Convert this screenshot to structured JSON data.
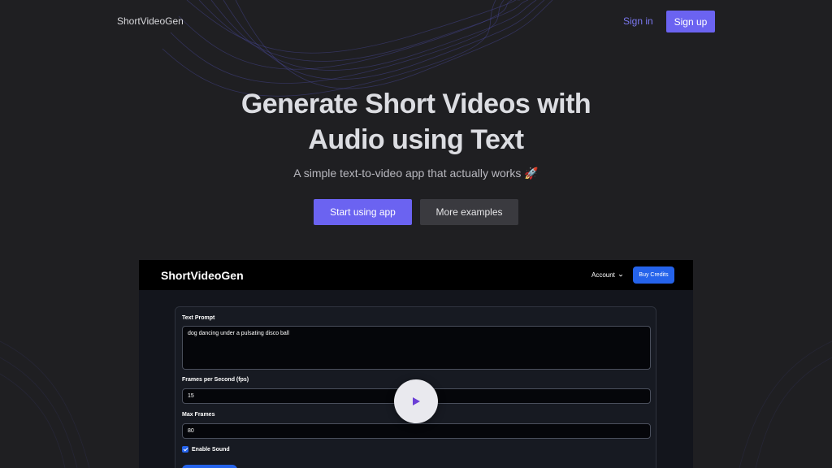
{
  "nav": {
    "brand": "ShortVideoGen",
    "signin_label": "Sign in",
    "signup_label": "Sign up"
  },
  "hero": {
    "title_line1": "Generate Short Videos with",
    "title_line2": "Audio using Text",
    "subtitle": "A simple text-to-video app that actually works 🚀",
    "primary_button": "Start using app",
    "secondary_button": "More examples"
  },
  "preview": {
    "brand": "ShortVideoGen",
    "account_label": "Account",
    "buy_credits_label": "Buy Credits",
    "form": {
      "prompt_label": "Text Prompt",
      "prompt_value": "dog dancing under a pulsating disco ball",
      "fps_label": "Frames per Second (fps)",
      "fps_value": "15",
      "max_frames_label": "Max Frames",
      "max_frames_value": "80",
      "enable_sound_label": "Enable Sound",
      "enable_sound_checked": true
    }
  },
  "colors": {
    "background": "#1f1f22",
    "accent": "#6b63f1",
    "app_blue": "#2563eb"
  },
  "icons": {
    "play": "play-icon",
    "account_chevron": "chevron-down-icon",
    "checkbox": "checkbox-checked-icon"
  }
}
